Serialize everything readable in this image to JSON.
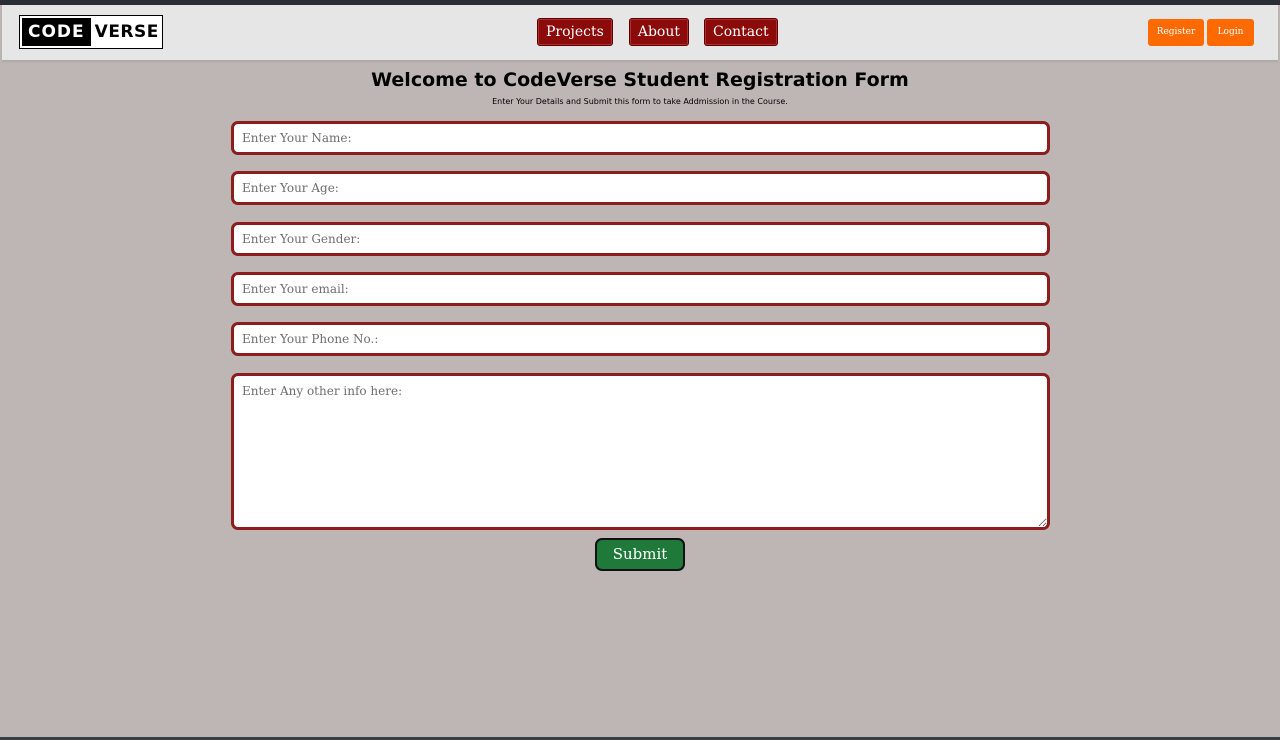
{
  "navbar": {
    "logo": {
      "left_text": "CODE",
      "right_text": "VERSE"
    },
    "links": [
      "Projects",
      "About",
      "Contact"
    ],
    "register_label": "Register",
    "login_label": "Login"
  },
  "form": {
    "title": "Welcome to CodeVerse Student Registration Form",
    "subtitle": "Enter Your Details and Submit this form to take Addmission in the Course.",
    "name_placeholder": "Enter Your Name:",
    "age_placeholder": "Enter Your Age:",
    "gender_placeholder": "Enter Your Gender:",
    "email_placeholder": "Enter Your email:",
    "phone_placeholder": "Enter Your Phone No.:",
    "info_placeholder": "Enter Any other info here:",
    "submit_label": "Submit"
  },
  "colors": {
    "page_background": "#bdb6b5",
    "navbar_background": "#e6e6e6",
    "nav_button": "#8b0a0a",
    "auth_button": "#ff6a00",
    "field_border": "#8b1d1d",
    "submit_button": "#1f7a3a"
  }
}
